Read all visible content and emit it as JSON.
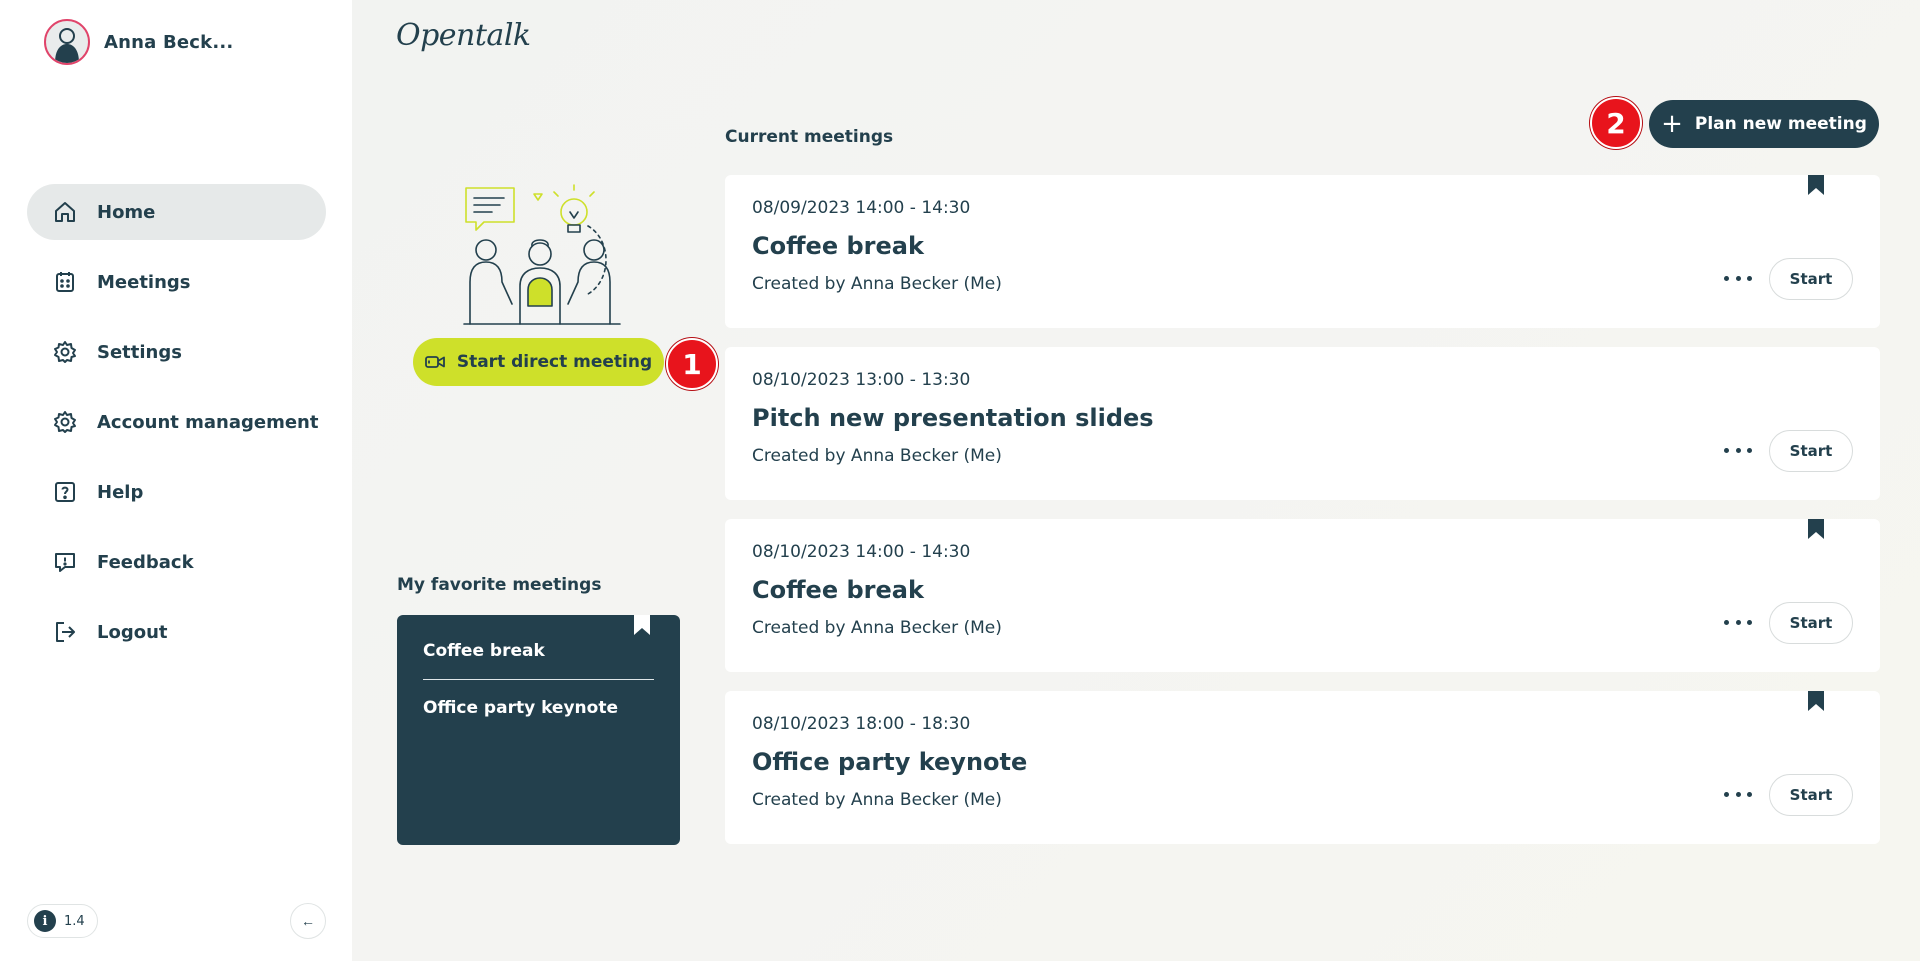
{
  "profile": {
    "name": "Anna Beck..."
  },
  "sidebar": {
    "items": [
      {
        "label": "Home",
        "icon": "home-icon",
        "active": true
      },
      {
        "label": "Meetings",
        "icon": "calendar-icon",
        "active": false
      },
      {
        "label": "Settings",
        "icon": "gear-icon",
        "active": false
      },
      {
        "label": "Account management",
        "icon": "gear-icon",
        "active": false
      },
      {
        "label": "Help",
        "icon": "help-icon",
        "active": false
      },
      {
        "label": "Feedback",
        "icon": "feedback-icon",
        "active": false
      },
      {
        "label": "Logout",
        "icon": "logout-icon",
        "active": false
      }
    ],
    "version": "1.4",
    "info_symbol": "i",
    "collapse_symbol": "←"
  },
  "brand": {
    "logo_text": "Opentalk"
  },
  "direct_meeting": {
    "label": "Start direct meeting",
    "step_marker": "1"
  },
  "favorites": {
    "title": "My favorite meetings",
    "items": [
      "Coffee break",
      "Office party keynote"
    ]
  },
  "current_meetings": {
    "title": "Current meetings",
    "plan_label": "Plan new meeting",
    "plan_symbol": "+",
    "step_marker": "2",
    "meetings": [
      {
        "time": "08/09/2023 14:00 - 14:30",
        "title": "Coffee break",
        "creator": "Created by Anna Becker (Me)",
        "favorite": true,
        "start_label": "Start"
      },
      {
        "time": "08/10/2023 13:00 - 13:30",
        "title": "Pitch new presentation slides",
        "creator": "Created by Anna Becker (Me)",
        "favorite": false,
        "start_label": "Start"
      },
      {
        "time": "08/10/2023 14:00 - 14:30",
        "title": "Coffee break",
        "creator": "Created by Anna Becker (Me)",
        "favorite": true,
        "start_label": "Start"
      },
      {
        "time": "08/10/2023 18:00 - 18:30",
        "title": "Office party keynote",
        "creator": "Created by Anna Becker (Me)",
        "favorite": true,
        "start_label": "Start"
      }
    ]
  },
  "colors": {
    "primary": "#23404d",
    "accent": "#cee02a",
    "marker": "#e8141c",
    "avatar_ring": "#e0446a"
  }
}
